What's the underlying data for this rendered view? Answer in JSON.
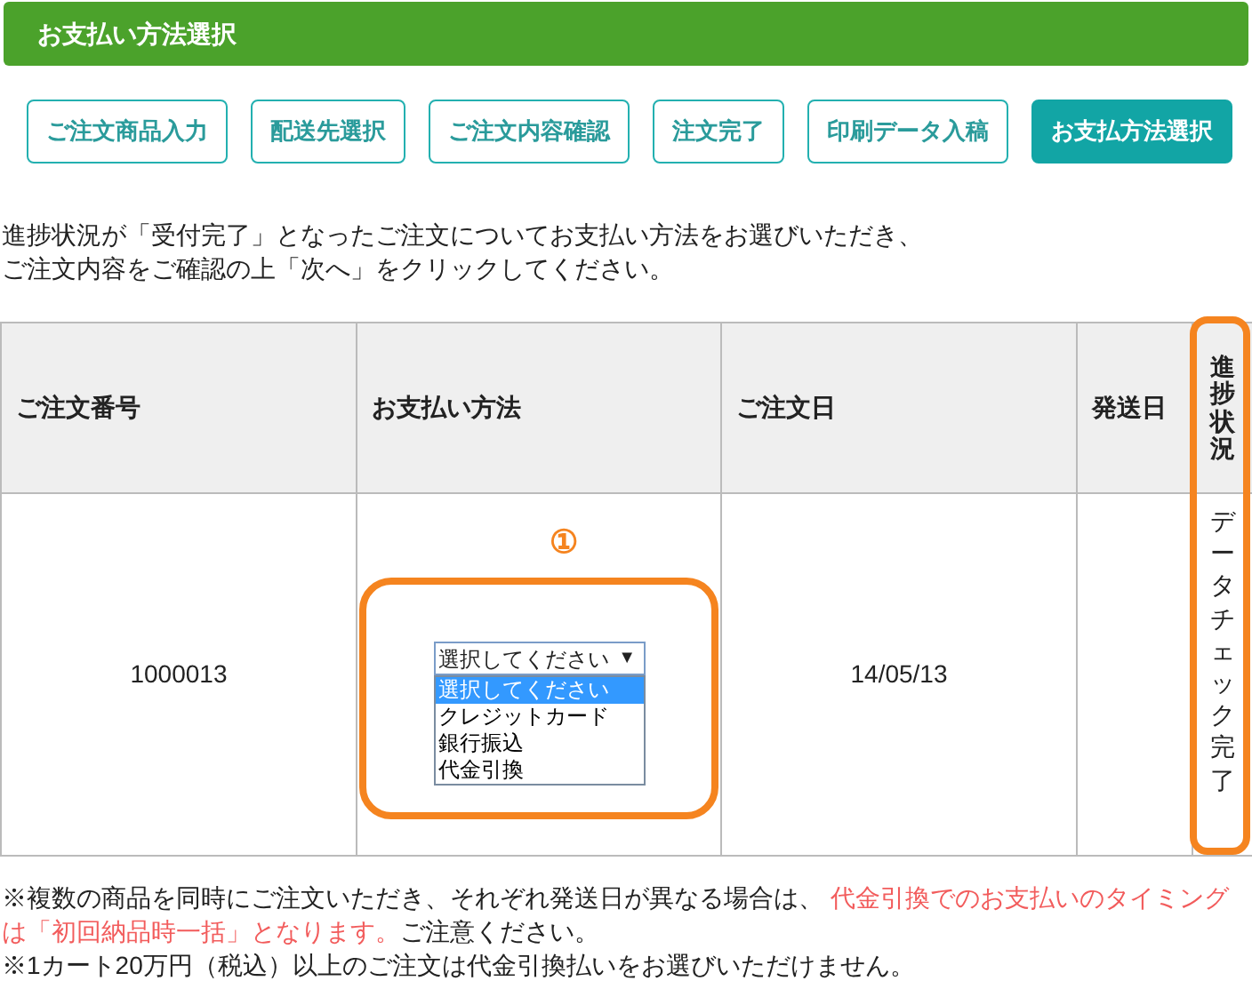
{
  "header": {
    "title": "お支払い方法選択"
  },
  "steps": [
    {
      "label": "ご注文商品入力",
      "selected": false
    },
    {
      "label": "配送先選択",
      "selected": false
    },
    {
      "label": "ご注文内容確認",
      "selected": false
    },
    {
      "label": "注文完了",
      "selected": false
    },
    {
      "label": "印刷データ入稿",
      "selected": false
    },
    {
      "label": "お支払方法選択",
      "selected": true
    }
  ],
  "intro": [
    "進捗状況が「受付完了」となったご注文についてお支払い方法をお選びいただき、",
    "ご注文内容をご確認の上「次へ」をクリックしてください。"
  ],
  "table": {
    "columns": [
      "ご注文番号",
      "お支払い方法",
      "ご注文日",
      "発送日",
      "進捗状況"
    ],
    "rows": [
      {
        "order_no": "1000013",
        "marker": "①",
        "select": {
          "value": "選択してください",
          "arrow": "▼",
          "expanded": true,
          "options": [
            {
              "label": "選択してください",
              "selected": true
            },
            {
              "label": "クレジットカード",
              "selected": false
            },
            {
              "label": "銀行振込",
              "selected": false
            },
            {
              "label": "代金引換",
              "selected": false
            }
          ]
        },
        "order_date": "14/05/13",
        "status": "データチェック完了"
      }
    ]
  },
  "notes": [
    [
      {
        "text": "※複数の商品を同時にご注文いただき、それぞれ発送日が異なる場合は、 ",
        "kind": "normal"
      },
      {
        "text": "代金引換でのお支払いのタイミングは「初回納品時一括」となります。",
        "kind": "warning"
      },
      {
        "text": "ご注意ください。",
        "kind": "normal"
      }
    ],
    [
      {
        "text": "※1カート20万円（税込）以上のご注文は代金引換払いをお選びいただけません。",
        "kind": "normal"
      }
    ]
  ]
}
